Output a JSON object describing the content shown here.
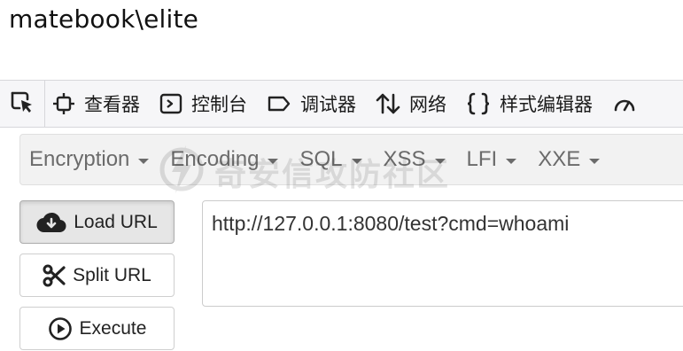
{
  "terminal": {
    "output": "matebook\\elite"
  },
  "devtools": {
    "tabs": [
      {
        "label": "查看器",
        "icon": "inspector-icon"
      },
      {
        "label": "控制台",
        "icon": "console-icon"
      },
      {
        "label": "调试器",
        "icon": "debugger-icon"
      },
      {
        "label": "网络",
        "icon": "network-icon"
      },
      {
        "label": "样式编辑器",
        "icon": "style-editor-icon"
      }
    ]
  },
  "hackbar": {
    "menu": [
      {
        "label": "Encryption"
      },
      {
        "label": "Encoding"
      },
      {
        "label": "SQL"
      },
      {
        "label": "XSS"
      },
      {
        "label": "LFI"
      },
      {
        "label": "XXE"
      }
    ],
    "buttons": {
      "load": "Load URL",
      "split": "Split URL",
      "execute": "Execute"
    },
    "url": "http://127.0.0.1:8080/test?cmd=whoami"
  },
  "watermark": {
    "text": "奇安信攻防社区"
  },
  "colors": {
    "toolbar_bg": "#f6f6f8",
    "menu_bg": "#f2f2f2",
    "menu_text": "#6b6b6b",
    "active_button_bg": "#e6e6e6"
  }
}
